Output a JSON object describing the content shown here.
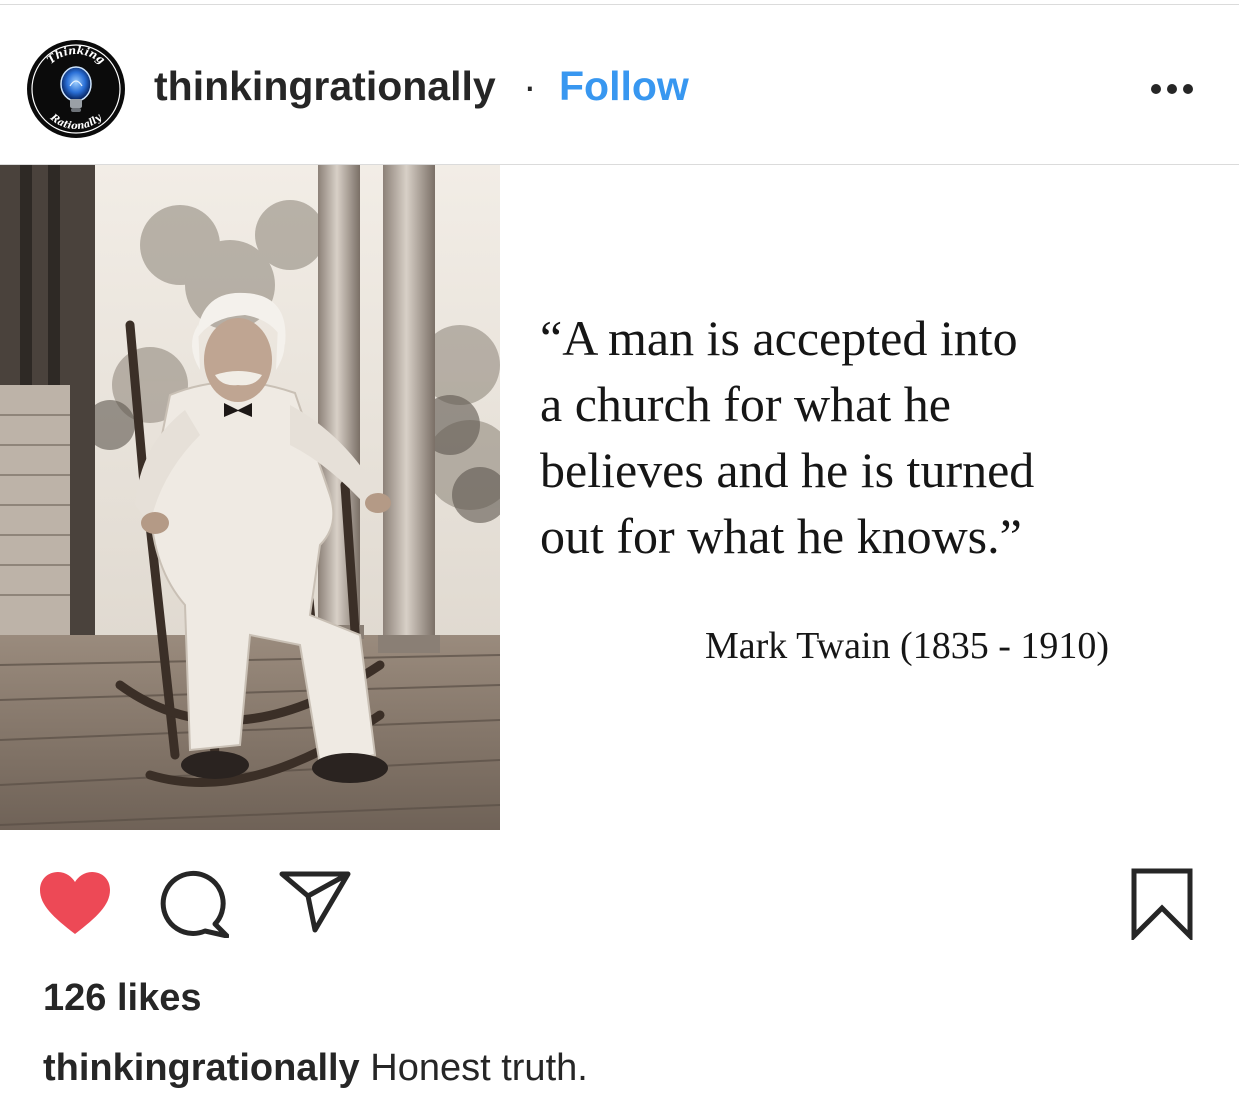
{
  "post": {
    "username": "thinkingrationally",
    "separator": "·",
    "follow_label": "Follow",
    "more_icon": "more-horizontal-icon",
    "avatar": {
      "top_text": "Thinking",
      "bottom_text": "Rationally"
    },
    "image": {
      "quote_lines": [
        "“A man is accepted into",
        "a church for what he",
        "believes and he is turned",
        "out for what he knows.”"
      ],
      "attribution": "Mark Twain (1835 - 1910)"
    },
    "actions": {
      "like_icon": "heart-filled-icon",
      "comment_icon": "comment-icon",
      "share_icon": "share-icon",
      "save_icon": "bookmark-icon",
      "liked_color": "#ed4956"
    },
    "likes_text": "126 likes",
    "caption": {
      "username": "thinkingrationally",
      "text": " Honest truth."
    }
  }
}
